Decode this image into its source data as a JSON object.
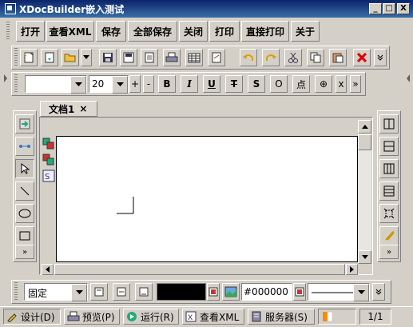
{
  "window": {
    "title": "XDocBuilder嵌入测试",
    "min": "_",
    "max": "□",
    "close": "X"
  },
  "menu": [
    "打开",
    "查看XML",
    "保存",
    "全部保存",
    "关闭",
    "打印",
    "直接打印",
    "关于"
  ],
  "format": {
    "font_name": "",
    "font_size": "20",
    "plus": "+",
    "minus": "-",
    "bold": "B",
    "italic": "I",
    "underline": "U",
    "strike": "T",
    "s": "S",
    "o": "O",
    "dian": "点",
    "sep": "⊕",
    "x": "x",
    "more": "»"
  },
  "tab": {
    "label": "文档1",
    "close": "×"
  },
  "bottom_toolbar": {
    "align_value": "固定",
    "color_value": "#000000"
  },
  "status": {
    "design": "设计(D)",
    "preview": "预览(P)",
    "run": "运行(R)",
    "view_xml": "查看XML",
    "server": "服务器(S)",
    "page": "1/1"
  },
  "left_toolbar": {
    "more": "»"
  },
  "right_toolbar": {
    "more": "»"
  }
}
